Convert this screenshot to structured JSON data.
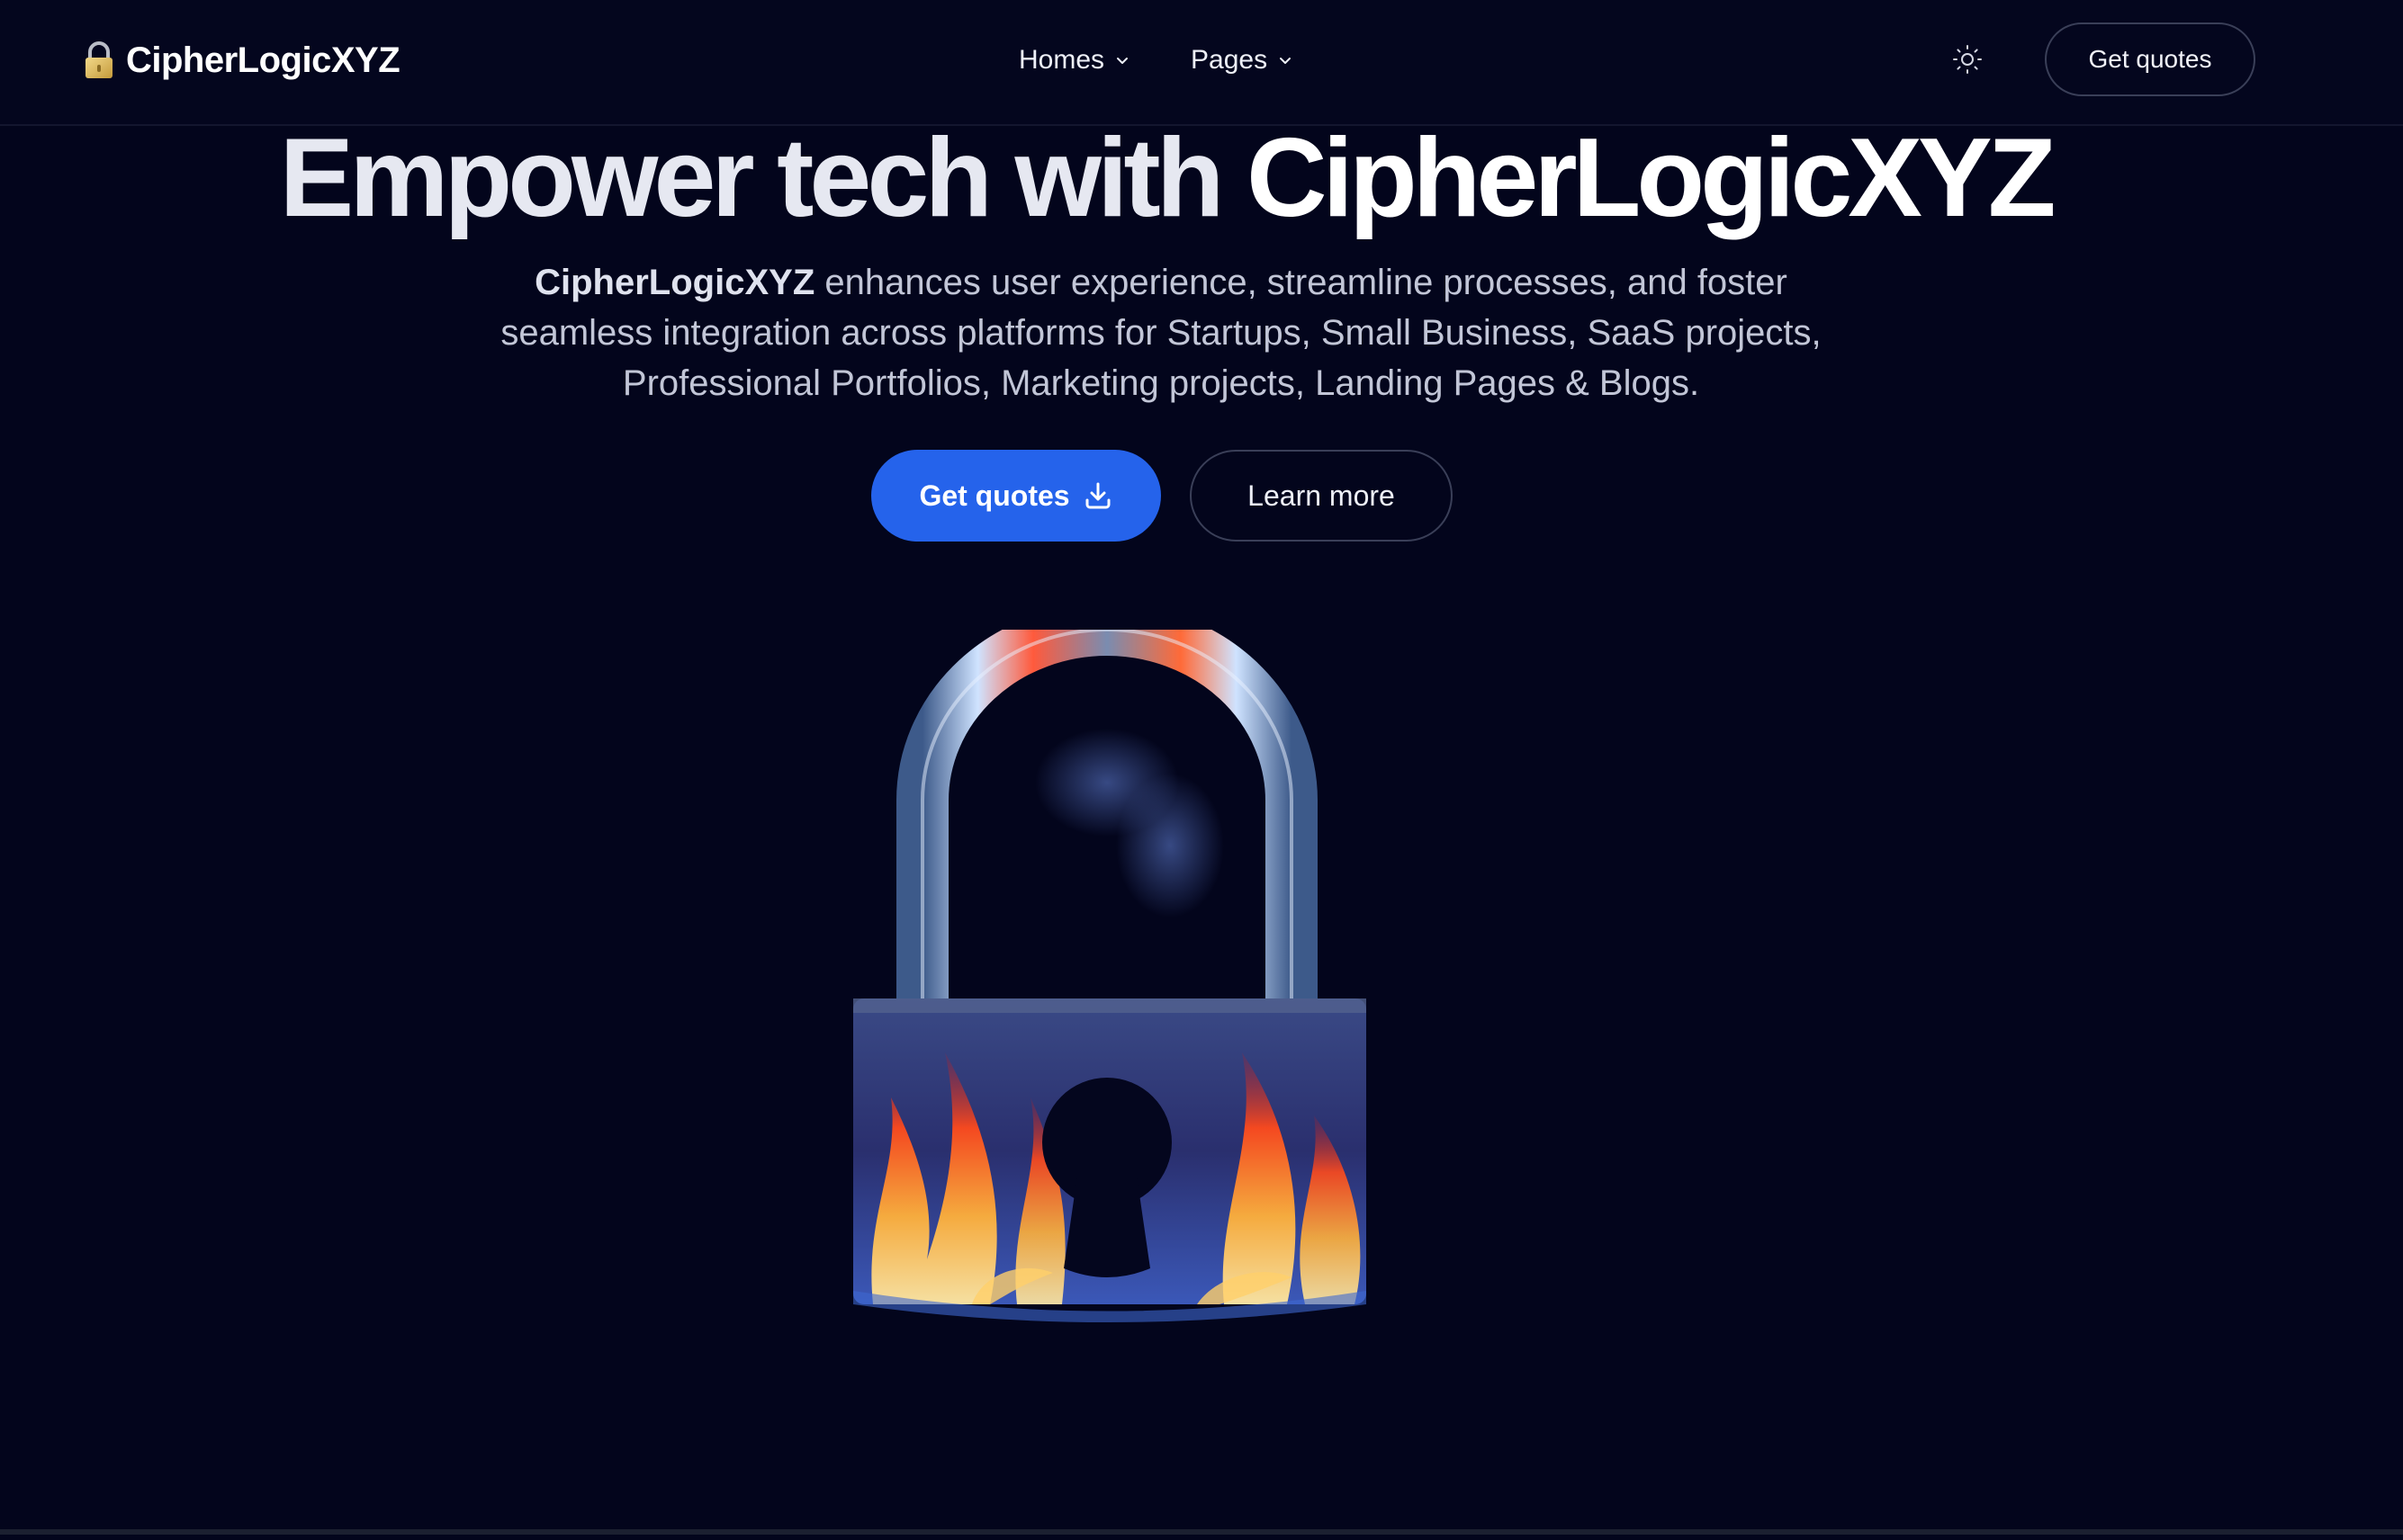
{
  "header": {
    "brand": "CipherLogicXYZ",
    "brand_icon": "padlock-emoji-icon",
    "nav": [
      {
        "label": "Homes",
        "icon": "chevron-down-icon"
      },
      {
        "label": "Pages",
        "icon": "chevron-down-icon"
      }
    ],
    "theme_toggle_icon": "sun-icon",
    "cta_label": "Get quotes"
  },
  "hero": {
    "title_prefix": "Empower tech with ",
    "title_brand": "CipherLogicXYZ",
    "subtitle_brand": "CipherLogicXYZ",
    "subtitle_rest": " enhances user experience, streamline processes, and foster seamless integration across platforms for Startups, Small Business, SaaS projects, Professional Portfolios, Marketing projects, Landing Pages & Blogs.",
    "primary_button": "Get quotes",
    "primary_button_icon": "download-icon",
    "secondary_button": "Learn more",
    "image": "flaming-padlock-illustration"
  },
  "colors": {
    "background": "#03051c",
    "primary": "#2563eb",
    "text": "#e7e9f3",
    "muted_text": "#c2c6d7",
    "border": "#3a3f58"
  }
}
